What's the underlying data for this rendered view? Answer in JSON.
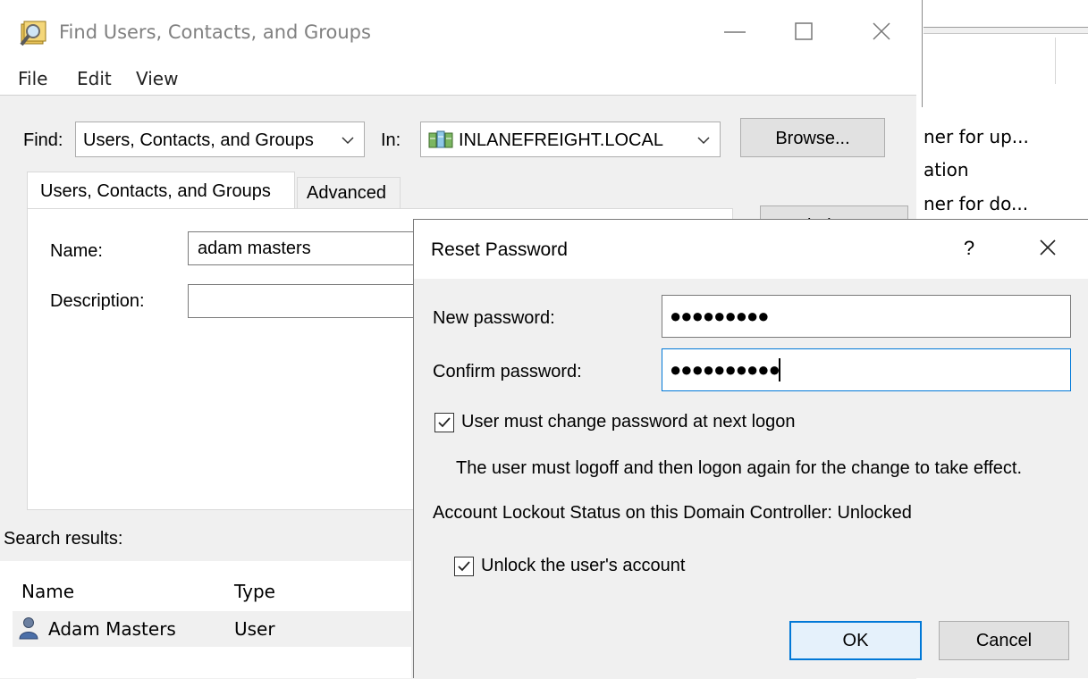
{
  "background_window": {
    "lines": [
      "ner for up...",
      "ation",
      "ner for do..."
    ]
  },
  "find_window": {
    "title": "Find Users, Contacts, and Groups",
    "menu": [
      "File",
      "Edit",
      "View"
    ],
    "find_label": "Find:",
    "find_value": "Users, Contacts, and Groups",
    "in_label": "In:",
    "in_value": "INLANEFREIGHT.LOCAL",
    "browse_label": "Browse...",
    "find_now_label": "Find Now",
    "tabs": [
      "Users, Contacts, and Groups",
      "Advanced"
    ],
    "name_label": "Name:",
    "name_value": "adam masters",
    "description_label": "Description:",
    "description_value": "",
    "search_results_label": "Search results:",
    "columns": [
      "Name",
      "Type"
    ],
    "rows": [
      {
        "name": "Adam Masters",
        "type": "User"
      }
    ]
  },
  "reset_dialog": {
    "title": "Reset Password",
    "help": "?",
    "new_password_label": "New password:",
    "new_password_value": "●●●●●●●●●",
    "confirm_password_label": "Confirm password:",
    "confirm_password_value": "●●●●●●●●●●",
    "must_change_label": "User must change password at next logon",
    "must_change_checked": true,
    "note": "The user must logoff and then logon again for the change to take effect.",
    "lockout_status": "Account Lockout Status on this Domain Controller: Unlocked",
    "unlock_label": "Unlock the user's account",
    "unlock_checked": true,
    "ok_label": "OK",
    "cancel_label": "Cancel"
  },
  "colors": {
    "dialog_bg": "#f0f0f0",
    "focus_border": "#0078d7",
    "title_gray": "#808080"
  }
}
